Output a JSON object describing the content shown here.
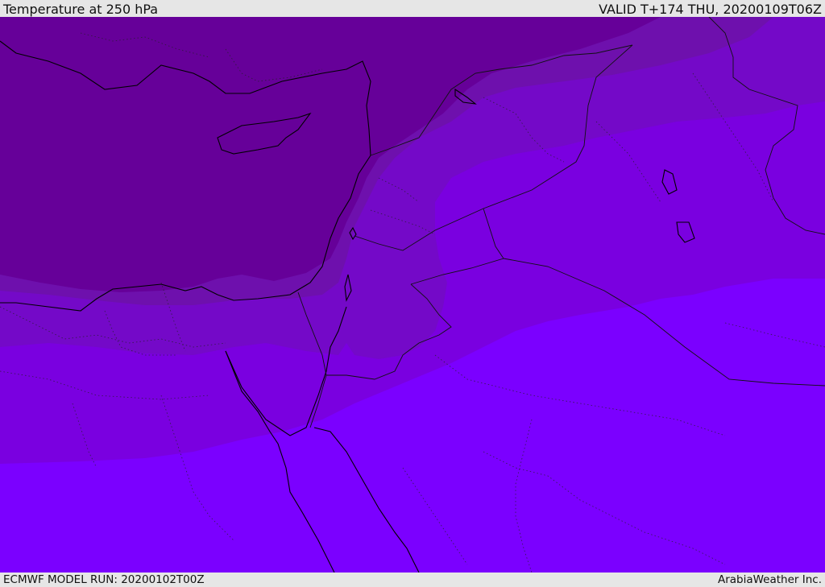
{
  "header": {
    "title": "Temperature at 250 hPa",
    "valid_time": "VALID T+174 THU, 20200109T06Z"
  },
  "footer": {
    "model_run": "ECMWF MODEL RUN: 20200102T00Z",
    "credit": "ArabiaWeather Inc."
  },
  "map": {
    "region": "Eastern Mediterranean, Levant, Egypt, Arabian Peninsula",
    "colors": {
      "coldest": "#660099",
      "cold": "#6e10ad",
      "mid": "#7409c8",
      "warm": "#7a00e0",
      "warmest": "#7b00ff",
      "coastline": "#000000",
      "border": "#111111"
    }
  }
}
